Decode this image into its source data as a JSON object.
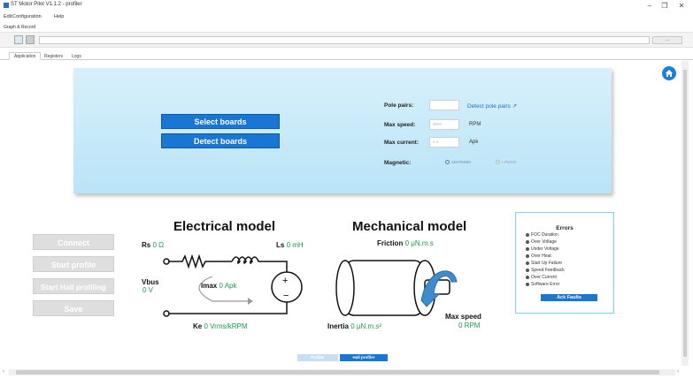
{
  "window": {
    "title": "ST Motor Pilot V1.1.2 - profiler",
    "minimize": "–",
    "restore": "❐",
    "close": "✕"
  },
  "menu": [
    "Edit",
    "Configuration",
    "Help"
  ],
  "graph_section_title": "Graph & Record",
  "toolbar": {
    "browse_label": "..."
  },
  "tabs": [
    {
      "label": "Application",
      "active": true
    },
    {
      "label": "Registers",
      "active": false
    },
    {
      "label": "Logs",
      "active": false
    }
  ],
  "left_buttons": {
    "connect": "Connect",
    "start_profile": "Start profile",
    "start_hall": "Start Hall profiling",
    "save": "Save"
  },
  "config_panel": {
    "select_boards": "Select boards",
    "detect_boards": "Detect boards",
    "pole_pairs_label": "Pole pairs:",
    "pole_pairs_value": "",
    "detect_pole_pairs": "Detect pole pairs",
    "max_speed_label": "Max speed:",
    "max_speed_placeholder": "3000",
    "max_speed_unit": "RPM",
    "max_current_label": "Max current:",
    "max_current_placeholder": "4.0",
    "max_current_unit": "Apk",
    "magnetic_label": "Magnetic:",
    "magnetic_options": [
      "SM-PMSM",
      "I-PMSM"
    ]
  },
  "electrical": {
    "title": "Electrical model",
    "rs_label": "Rs",
    "rs_value": "0 Ω",
    "ls_label": "Ls",
    "ls_value": "0 mH",
    "vbus_label": "Vbus",
    "vbus_value": "0 V",
    "imax_label": "Imax",
    "imax_value": "0 Apk",
    "ke_label": "Ke",
    "ke_value": "0 Vrms/kRPM"
  },
  "mechanical": {
    "title": "Mechanical model",
    "friction_label": "Friction",
    "friction_value": "0 μN.m.s",
    "inertia_label": "Inertia",
    "inertia_value": "0 μN.m.s²",
    "max_speed_label": "Max speed",
    "max_speed_value": "0 RPM"
  },
  "errors": {
    "title": "Errors",
    "items": [
      "FOC Duration",
      "Over Voltage",
      "Under Voltage",
      "Over Heat",
      "Start Up Failure",
      "Speed Feedback",
      "Over Current",
      "Software Error"
    ],
    "ack_label": "Ack Faults"
  },
  "bottom_tabs": [
    "Profiler",
    "Hall profiler"
  ],
  "colors": {
    "accent": "#1976d2",
    "value_green": "#1c9a4e",
    "panel": "#c9eaf8"
  }
}
